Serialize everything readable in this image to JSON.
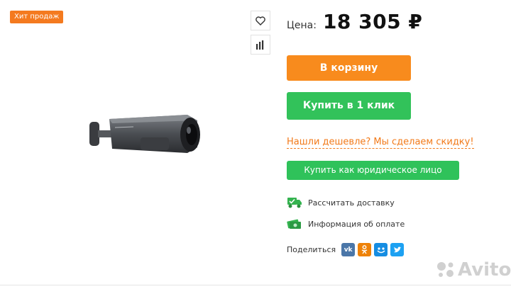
{
  "badge": {
    "label": "Хит продаж"
  },
  "price": {
    "label": "Цена:",
    "value": "18 305 ₽"
  },
  "buttons": {
    "cart": "В корзину",
    "one_click": "Купить в 1 клик",
    "cheaper_link": "Нашли дешевле? Мы сделаем скидку!",
    "legal_entity": "Купить как юридическое лицо"
  },
  "info": {
    "delivery": "Рассчитать доставку",
    "payment": "Информация об оплате"
  },
  "share": {
    "label": "Поделиться",
    "networks": [
      "vk-icon",
      "odnoklassniki-icon",
      "moimir-icon",
      "twitter-icon"
    ]
  },
  "watermark": {
    "text": "Avito"
  },
  "colors": {
    "orange": "#f88b1d",
    "green": "#32c25a",
    "badge": "#f47a1f",
    "link": "#f27a1a"
  }
}
